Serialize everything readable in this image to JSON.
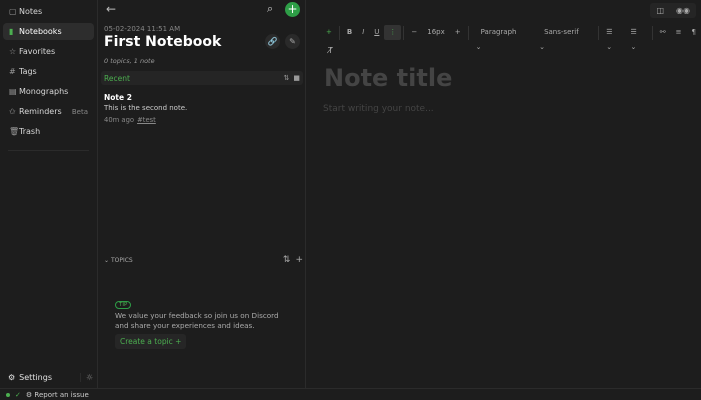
{
  "sidebar": {
    "items": [
      {
        "label": "Notes",
        "icon": "note-icon",
        "glyph": "▢"
      },
      {
        "label": "Notebooks",
        "icon": "notebook-icon",
        "glyph": "▮"
      },
      {
        "label": "Favorites",
        "icon": "star-icon",
        "glyph": "☆"
      },
      {
        "label": "Tags",
        "icon": "hash-icon",
        "glyph": "#"
      },
      {
        "label": "Monographs",
        "icon": "monograph-icon",
        "glyph": "▤"
      },
      {
        "label": "Reminders",
        "icon": "reminder-icon",
        "glyph": "✩",
        "badge": "Beta"
      },
      {
        "label": "Trash",
        "icon": "trash-icon",
        "glyph": "🗑"
      }
    ],
    "settings": "Settings"
  },
  "notebook": {
    "date": "05-02-2024 11:51 AM",
    "title": "First Notebook",
    "meta": "0 topics, 1 note",
    "section": "Recent",
    "notes": [
      {
        "title": "Note 2",
        "description": "This is the second note.",
        "time": "40m ago",
        "tag": "#test"
      }
    ],
    "topics_label": "TOPICS",
    "tip_badge": "TIP",
    "tip_text": "We value your feedback so join us on Discord and share your experiences and ideas.",
    "create_topic": "Create a topic"
  },
  "editor": {
    "font_size": "16px",
    "block": "Paragraph",
    "font": "Sans-serif",
    "title_placeholder": "Note title",
    "body_placeholder": "Start writing your note..."
  },
  "status": {
    "report": "Report an issue"
  },
  "colors": {
    "accent": "#2e9e47"
  }
}
